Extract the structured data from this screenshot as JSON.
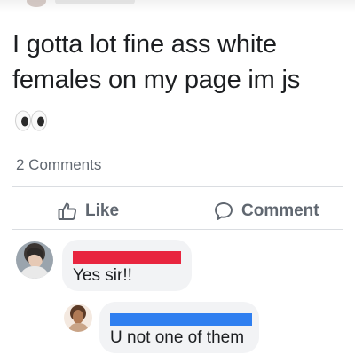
{
  "post": {
    "text": "I gotta lot fine ass white females on my page im js",
    "emoji_icon": "eyes-emoji-icon"
  },
  "comments_count": "2 Comments",
  "actions": {
    "like_label": "Like",
    "like_icon": "thumbs-up-icon",
    "comment_label": "Comment",
    "comment_icon": "speech-bubble-icon"
  },
  "comments": [
    {
      "text": "Yes sir!!",
      "name_redaction_color": "#e8253f"
    },
    {
      "text": "U not one of them",
      "name_redaction_color": "#2f7ff0"
    }
  ],
  "colors": {
    "text_primary": "#1c1e21",
    "text_secondary": "#606770",
    "bubble_bg": "#f2f3f5",
    "divider": "#dadde1"
  }
}
